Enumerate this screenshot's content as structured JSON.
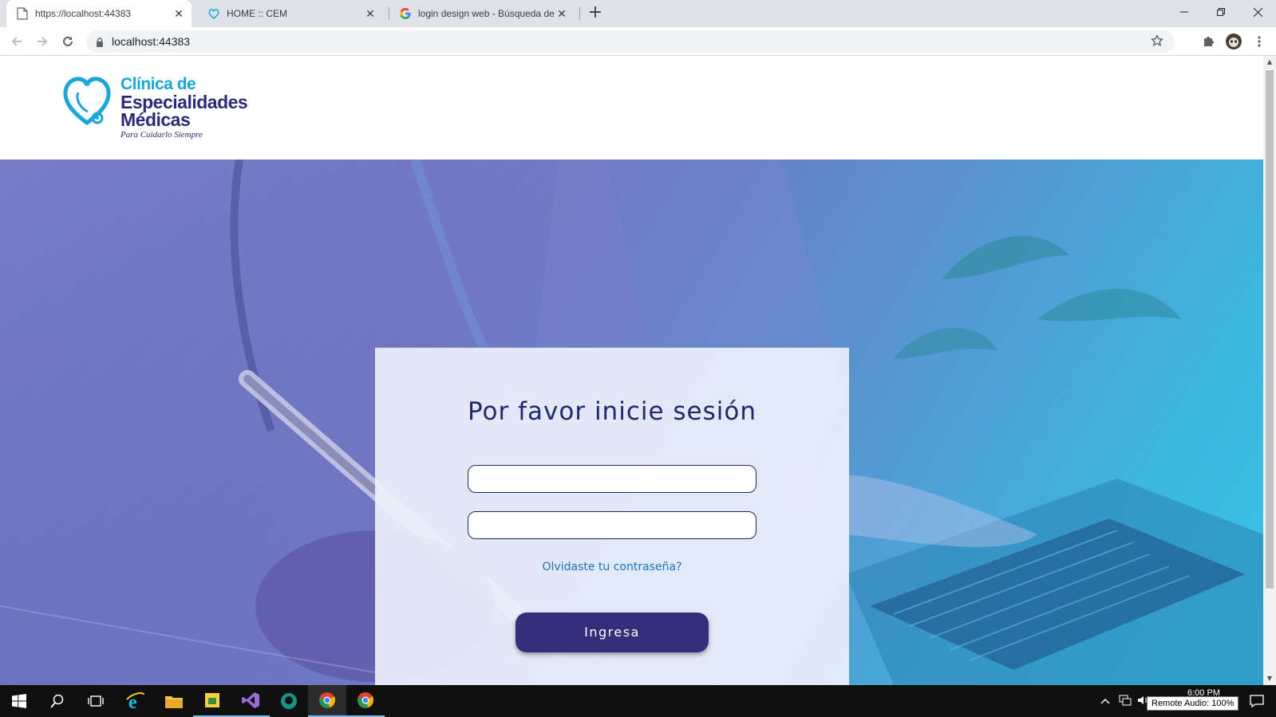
{
  "browser": {
    "tabs": [
      {
        "title": "https://localhost:44383",
        "favicon": "page-icon",
        "active": true
      },
      {
        "title": "HOME :: CEM",
        "favicon": "cem-logo-icon",
        "active": false
      },
      {
        "title": "login design web - Búsqueda de",
        "favicon": "google-icon",
        "active": false
      }
    ],
    "address": "localhost:44383"
  },
  "site": {
    "logo": {
      "line1": "Clínica de",
      "line2": "Especialidades",
      "line3": "Médicas",
      "tagline": "Para Cuidarlo Siempre"
    }
  },
  "login": {
    "heading": "Por favor inicie sesión",
    "username_placeholder": "",
    "password_placeholder": "",
    "forgot_link": "Olvidaste tu contraseña?",
    "submit_label": "Ingresa"
  },
  "taskbar": {
    "clock_time": "6:00 PM",
    "tooltip": "Remote Audio: 100%"
  },
  "colors": {
    "brand_dark": "#2e2a7a",
    "brand_light": "#1aa6d6",
    "button": "#332d7a",
    "link": "#1a73c8"
  }
}
